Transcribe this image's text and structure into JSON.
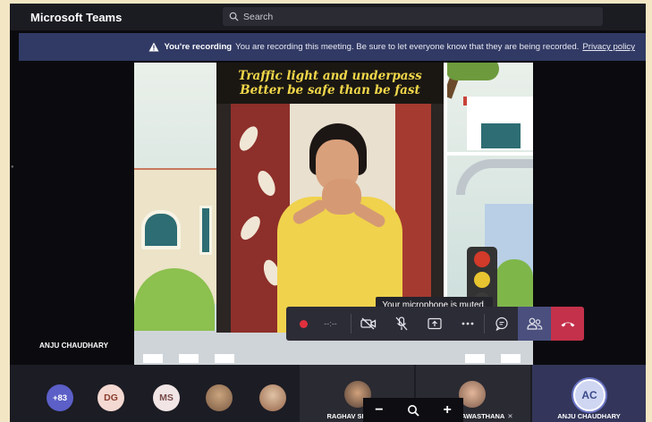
{
  "app": {
    "title": "Microsoft Teams"
  },
  "search": {
    "placeholder": "Search"
  },
  "banner": {
    "title": "You're recording",
    "message": "You are recording this meeting. Be sure to let everyone know that they are being recorded.",
    "link": "Privacy policy"
  },
  "video": {
    "title_line1": "Traffic light and underpass",
    "title_line2": "Better be safe than be fast",
    "speaker_name": "ANJU CHAUDHARY"
  },
  "tooltip": "Your microphone is muted.",
  "controls": {
    "timer": "--:--"
  },
  "participants": {
    "more": "+83",
    "avatars": [
      "DG",
      "MS"
    ],
    "tiles": [
      {
        "name": "RAGHAV SHARMA"
      },
      {
        "name": "SHIVANI AWASTHANA"
      },
      {
        "name": "ANJU CHAUDHARY",
        "initials": "AC"
      }
    ]
  },
  "zoom": {
    "minus": "−",
    "plus": "+"
  },
  "colors": {
    "accent": "#5b5fc7",
    "recording": "#e0303e",
    "hangup": "#c4314b",
    "banner": "#313a64"
  }
}
